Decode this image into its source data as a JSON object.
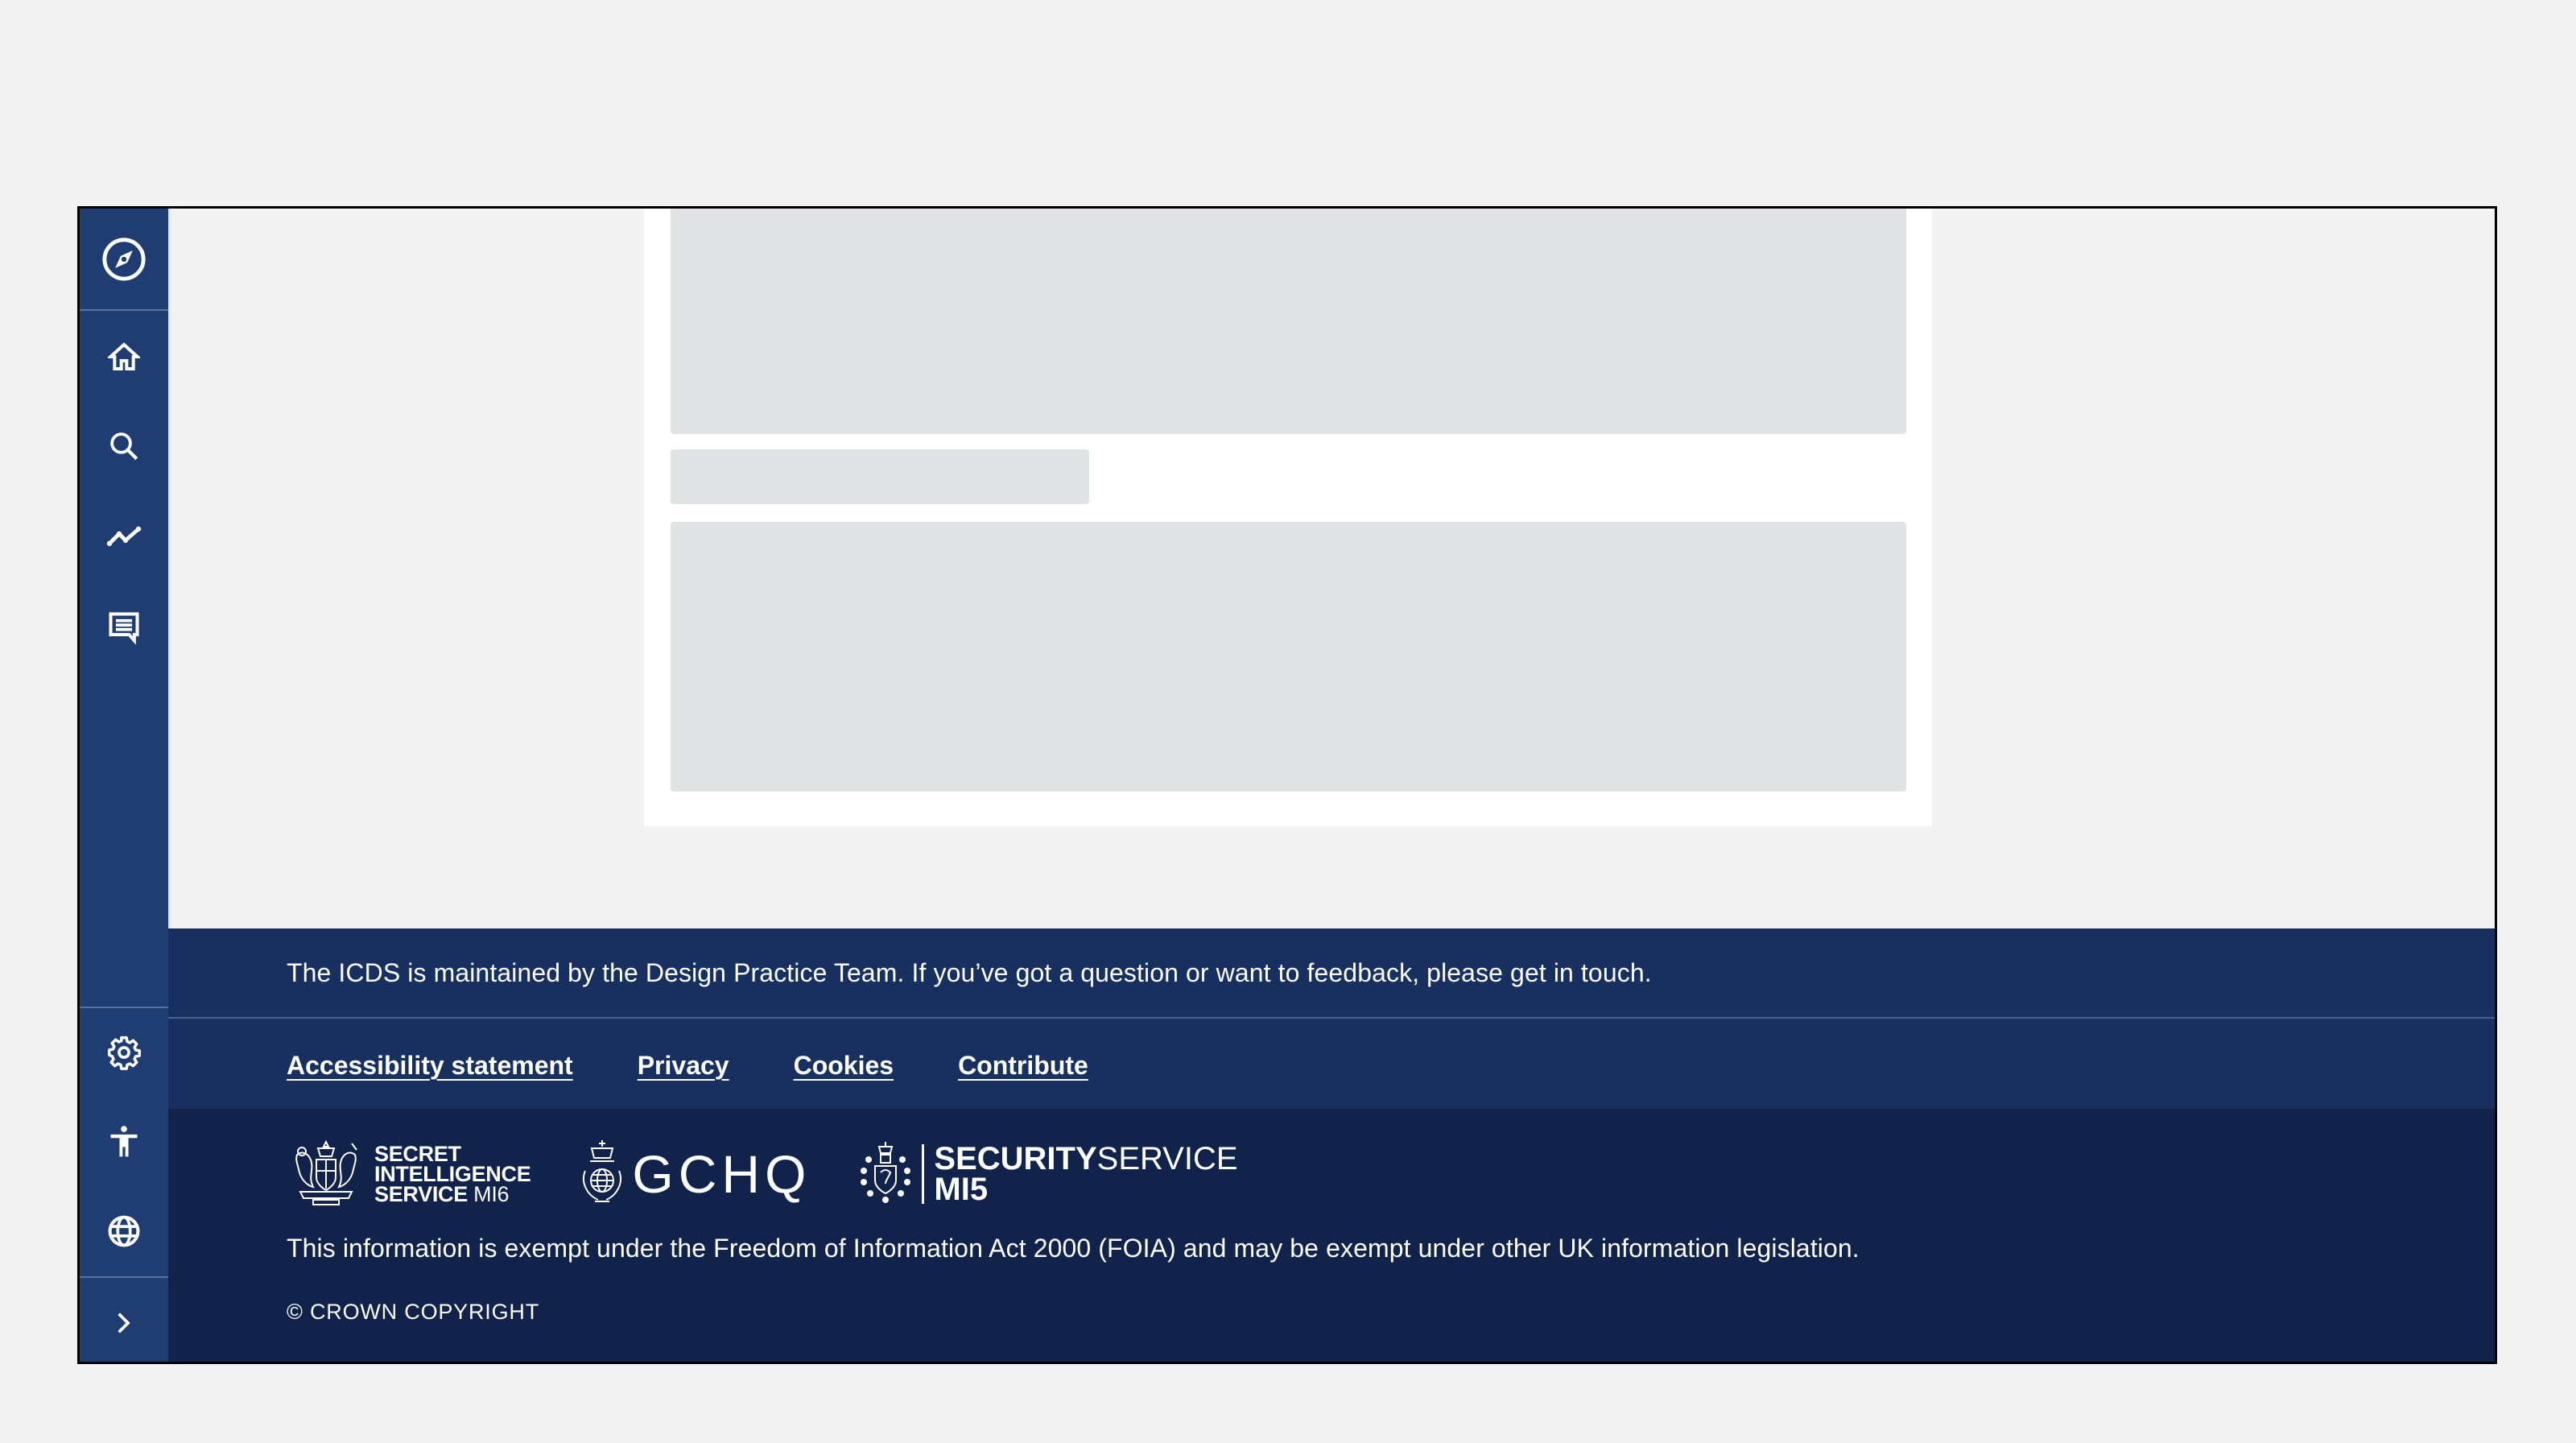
{
  "sidebar": {
    "top_item": {
      "icon": "compass-icon",
      "label": "Explore"
    },
    "items": [
      {
        "icon": "home-icon",
        "label": "Home"
      },
      {
        "icon": "search-icon",
        "label": "Search"
      },
      {
        "icon": "trending-icon",
        "label": "Analytics"
      },
      {
        "icon": "message-icon",
        "label": "Messages"
      }
    ],
    "bottom_items": [
      {
        "icon": "gear-icon",
        "label": "Settings"
      },
      {
        "icon": "accessibility-icon",
        "label": "Accessibility"
      },
      {
        "icon": "globe-icon",
        "label": "Language"
      }
    ],
    "expand": {
      "icon": "chevron-right-icon",
      "label": "Expand"
    }
  },
  "main": {
    "loading_state": "skeleton placeholders"
  },
  "footer": {
    "message": "The ICDS is maintained by the Design Practice Team. If you’ve got a question or want to feedback, please get in touch.",
    "links": [
      {
        "label": "Accessibility statement"
      },
      {
        "label": "Privacy"
      },
      {
        "label": "Cookies"
      },
      {
        "label": "Contribute"
      }
    ],
    "logos": {
      "mi6": {
        "line1": "SECRET",
        "line2": "INTELLIGENCE",
        "line3_bold": "SERVICE",
        "line3_thin": "MI6"
      },
      "gchq": {
        "text": "GCHQ"
      },
      "mi5": {
        "line1_bold": "SECURITY",
        "line1_thin": "SERVICE",
        "line2": "MI5"
      }
    },
    "foia": "This information is exempt under the Freedom of Information Act 2000 (FOIA) and may be exempt under other UK information legislation.",
    "copyright": "© CROWN COPYRIGHT"
  },
  "colors": {
    "sidebar": "#1f3d73",
    "footer_top": "#17305f",
    "footer_bottom": "#11234a",
    "skeleton": "#e1e2e4",
    "page_bg": "#f3f3f3"
  }
}
